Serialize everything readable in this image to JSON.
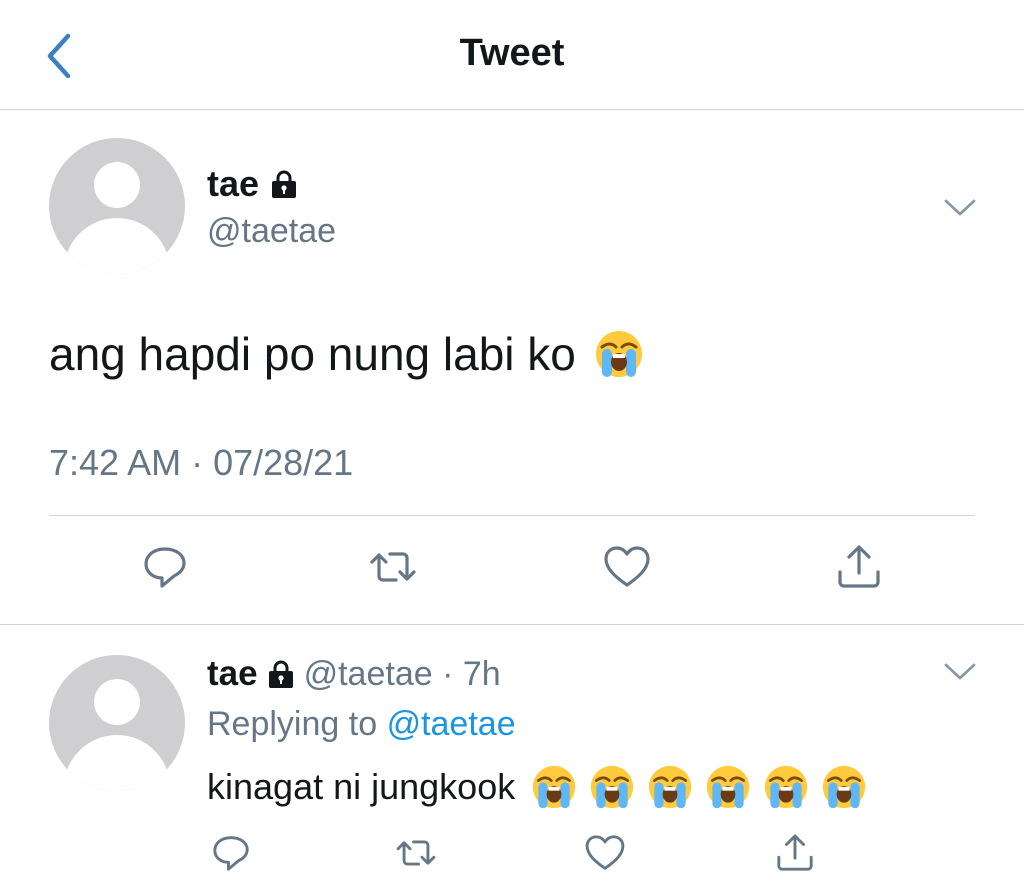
{
  "header": {
    "title": "Tweet",
    "back_icon": "chevron-left-icon"
  },
  "main_tweet": {
    "name": "tae",
    "handle": "@taetae",
    "text": "ang hapdi po nung labi ko",
    "emoji": "loudly-crying-face",
    "timestamp": "7:42 AM · 07/28/21",
    "actions": [
      "reply-icon",
      "retweet-icon",
      "like-icon",
      "share-icon"
    ]
  },
  "reply_tweet": {
    "name": "tae",
    "handle_time": "@taetae · 7h",
    "replying_prefix": "Replying to",
    "replying_to": "@taetae",
    "text": "kinagat ni jungkook",
    "emoji_count": 6,
    "emoji": "loudly-crying-face"
  },
  "colors": {
    "text": "#14171a",
    "secondary": "#657786",
    "accent": "#1b95e0",
    "avatar": "#cfcfd1",
    "divider": "#cfd3d6"
  }
}
